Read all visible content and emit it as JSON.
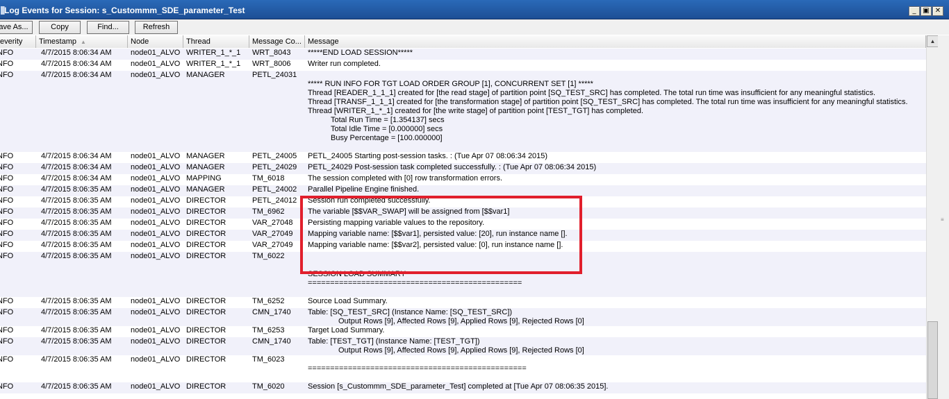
{
  "window": {
    "title": "Log Events for Session: s_Custommm_SDE_parameter_Test",
    "buttons": [
      "_",
      "▣",
      "✕"
    ]
  },
  "toolbar": {
    "save_as": "ave As...",
    "copy": "Copy",
    "find": "Find...",
    "refresh": "Refresh"
  },
  "columns": {
    "severity": "everity",
    "timestamp": "Timestamp",
    "node": "Node",
    "thread": "Thread",
    "code": "Message Co...",
    "message": "Message"
  },
  "rows": [
    {
      "sev": "NFO",
      "ts": "4/7/2015 8:06:34 AM",
      "node": "node01_ALVO",
      "thread": "WRITER_1_*_1",
      "code": "WRT_8043",
      "msg": [
        "*****END LOAD SESSION*****"
      ]
    },
    {
      "sev": "NFO",
      "ts": "4/7/2015 8:06:34 AM",
      "node": "node01_ALVO",
      "thread": "WRITER_1_*_1",
      "code": "WRT_8006",
      "msg": [
        "Writer run completed."
      ]
    },
    {
      "sev": "NFO",
      "ts": "4/7/2015 8:06:34 AM",
      "node": "node01_ALVO",
      "thread": "MANAGER",
      "code": "PETL_24031",
      "msg": [
        "",
        "***** RUN INFO FOR TGT LOAD ORDER GROUP [1], CONCURRENT SET [1] *****",
        "Thread [READER_1_1_1] created for [the read stage] of partition point [SQ_TEST_SRC] has completed. The total run time was insufficient for any meaningful statistics.",
        "Thread [TRANSF_1_1_1] created for [the transformation stage] of partition point [SQ_TEST_SRC] has completed. The total run time was insufficient for any meaningful statistics.",
        "Thread [WRITER_1_*_1] created for [the write stage] of partition point [TEST_TGT] has completed.",
        "   Total Run Time = [1.354137] secs",
        "   Total Idle Time = [0.000000] secs",
        "   Busy Percentage = [100.000000]"
      ]
    },
    {
      "sev": "NFO",
      "ts": "4/7/2015 8:06:34 AM",
      "node": "node01_ALVO",
      "thread": "MANAGER",
      "code": "PETL_24005",
      "msg": [
        "PETL_24005 Starting post-session tasks. : (Tue Apr 07 08:06:34 2015)"
      ]
    },
    {
      "sev": "NFO",
      "ts": "4/7/2015 8:06:34 AM",
      "node": "node01_ALVO",
      "thread": "MANAGER",
      "code": "PETL_24029",
      "msg": [
        "PETL_24029 Post-session task completed successfully. : (Tue Apr 07 08:06:34 2015)"
      ]
    },
    {
      "sev": "NFO",
      "ts": "4/7/2015 8:06:34 AM",
      "node": "node01_ALVO",
      "thread": "MAPPING",
      "code": "TM_6018",
      "msg": [
        "The session completed with [0] row transformation errors."
      ]
    },
    {
      "sev": "NFO",
      "ts": "4/7/2015 8:06:35 AM",
      "node": "node01_ALVO",
      "thread": "MANAGER",
      "code": "PETL_24002",
      "msg": [
        "Parallel Pipeline Engine finished."
      ]
    },
    {
      "sev": "NFO",
      "ts": "4/7/2015 8:06:35 AM",
      "node": "node01_ALVO",
      "thread": "DIRECTOR",
      "code": "PETL_24012",
      "msg": [
        "Session run completed successfully."
      ]
    },
    {
      "sev": "NFO",
      "ts": "4/7/2015 8:06:35 AM",
      "node": "node01_ALVO",
      "thread": "DIRECTOR",
      "code": "TM_6962",
      "msg": [
        "The variable [$$VAR_SWAP] will be assigned from [$$var1]"
      ]
    },
    {
      "sev": "NFO",
      "ts": "4/7/2015 8:06:35 AM",
      "node": "node01_ALVO",
      "thread": "DIRECTOR",
      "code": "VAR_27048",
      "msg": [
        "Persisting mapping variable values to the repository."
      ]
    },
    {
      "sev": "NFO",
      "ts": "4/7/2015 8:06:35 AM",
      "node": "node01_ALVO",
      "thread": "DIRECTOR",
      "code": "VAR_27049",
      "msg": [
        "Mapping variable name: [$$var1], persisted value: [20], run instance name []."
      ]
    },
    {
      "sev": "NFO",
      "ts": "4/7/2015 8:06:35 AM",
      "node": "node01_ALVO",
      "thread": "DIRECTOR",
      "code": "VAR_27049",
      "msg": [
        "Mapping variable name: [$$var2], persisted value: [0], run instance name []."
      ]
    },
    {
      "sev": "NFO",
      "ts": "4/7/2015 8:06:35 AM",
      "node": "node01_ALVO",
      "thread": "DIRECTOR",
      "code": "TM_6022",
      "msg": [
        "",
        "",
        "SESSION LOAD SUMMARY",
        "================================================"
      ]
    },
    {
      "sev": "NFO",
      "ts": "4/7/2015 8:06:35 AM",
      "node": "node01_ALVO",
      "thread": "DIRECTOR",
      "code": "TM_6252",
      "msg": [
        "Source Load Summary."
      ]
    },
    {
      "sev": "NFO",
      "ts": "4/7/2015 8:06:35 AM",
      "node": "node01_ALVO",
      "thread": "DIRECTOR",
      "code": "CMN_1740",
      "msg": [
        "Table: [SQ_TEST_SRC] (Instance Name: [SQ_TEST_SRC])",
        "    Output Rows [9], Affected Rows [9], Applied Rows [9], Rejected Rows [0]"
      ]
    },
    {
      "sev": "NFO",
      "ts": "4/7/2015 8:06:35 AM",
      "node": "node01_ALVO",
      "thread": "DIRECTOR",
      "code": "TM_6253",
      "msg": [
        "Target Load Summary."
      ]
    },
    {
      "sev": "NFO",
      "ts": "4/7/2015 8:06:35 AM",
      "node": "node01_ALVO",
      "thread": "DIRECTOR",
      "code": "CMN_1740",
      "msg": [
        "Table: [TEST_TGT] (Instance Name: [TEST_TGT])",
        "    Output Rows [9], Affected Rows [9], Applied Rows [9], Rejected Rows [0]"
      ]
    },
    {
      "sev": "NFO",
      "ts": "4/7/2015 8:06:35 AM",
      "node": "node01_ALVO",
      "thread": "DIRECTOR",
      "code": "TM_6023",
      "msg": [
        "",
        "================================================="
      ]
    },
    {
      "sev": "NFO",
      "ts": "4/7/2015 8:06:35 AM",
      "node": "node01_ALVO",
      "thread": "DIRECTOR",
      "code": "TM_6020",
      "msg": [
        "Session [s_Custommm_SDE_parameter_Test] completed at [Tue Apr 07 08:06:35 2015]."
      ]
    }
  ],
  "colors": {
    "title_bar": "#1d4f95",
    "alt_row": "#f1f1fa",
    "highlight_box": "#e11f2c"
  }
}
